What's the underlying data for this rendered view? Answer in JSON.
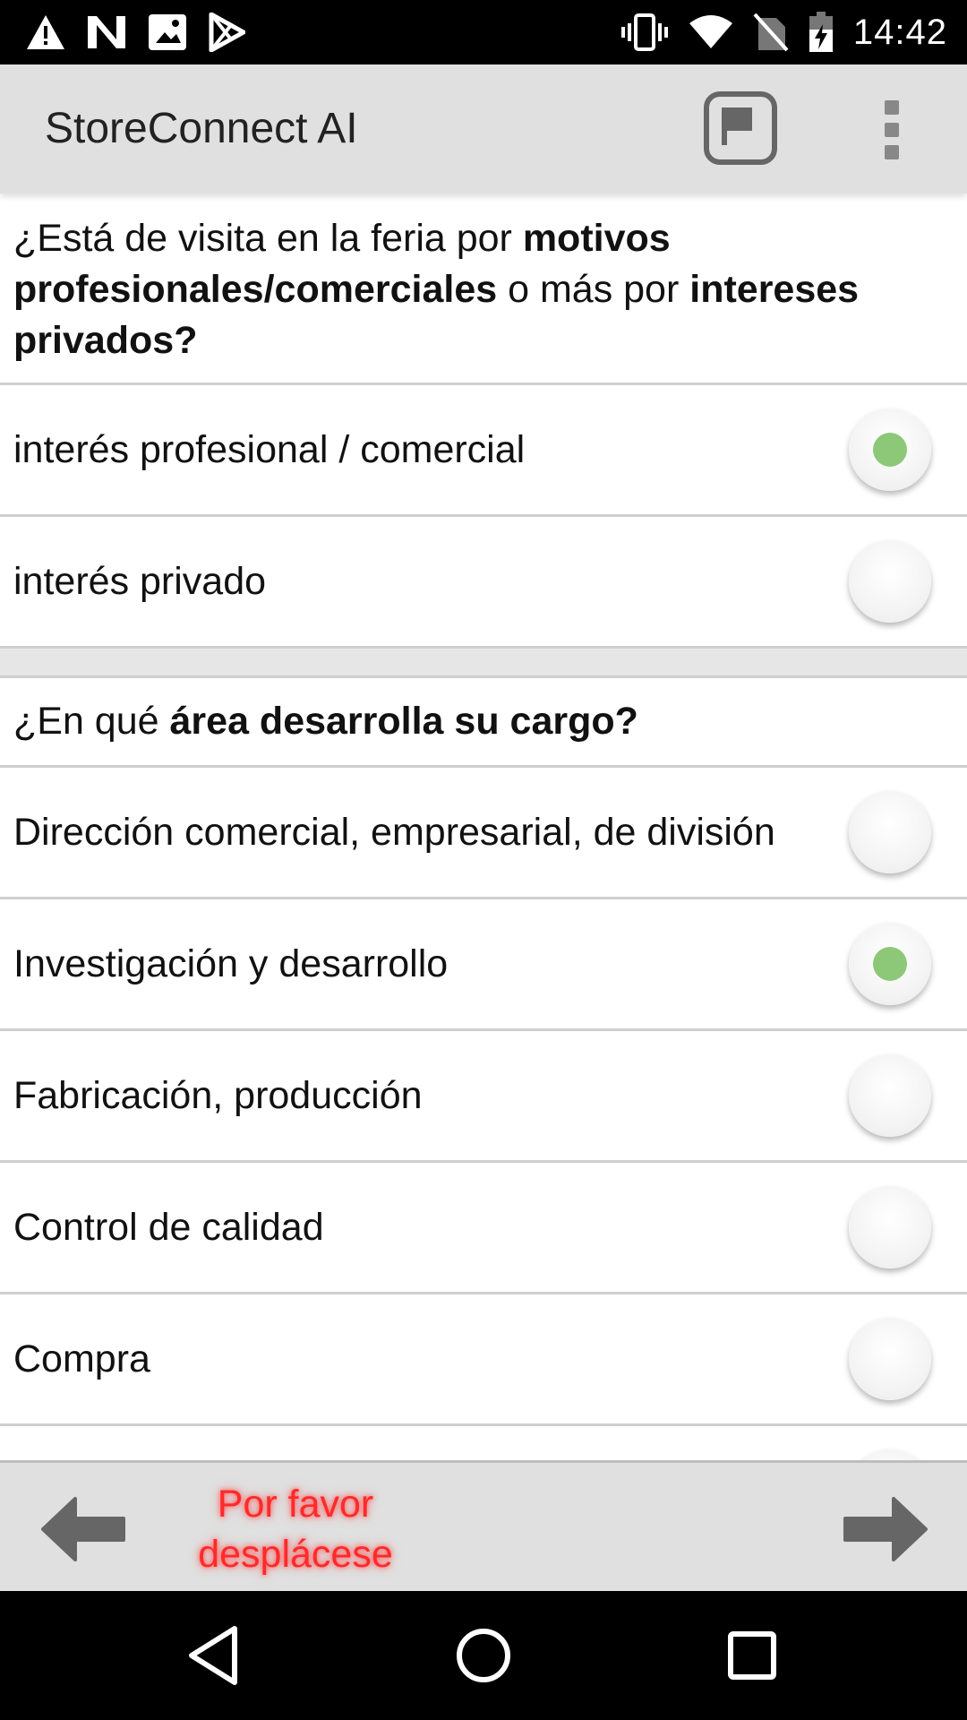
{
  "status_bar": {
    "time": "14:42",
    "left_icons": [
      "warning-icon",
      "n-icon",
      "gallery-icon",
      "play-store-icon"
    ],
    "right_icons": [
      "vibrate-icon",
      "wifi-icon",
      "no-sim-icon",
      "battery-charging-icon"
    ]
  },
  "app_bar": {
    "title": "StoreConnect AI",
    "actions": [
      "flag-icon",
      "more-vert-icon"
    ]
  },
  "questions": [
    {
      "parts": [
        {
          "text": "¿Está de visita en la feria por ",
          "bold": false
        },
        {
          "text": "motivos profesionales/comerciales",
          "bold": true
        },
        {
          "text": " o más por ",
          "bold": false
        },
        {
          "text": "intereses privados?",
          "bold": true
        }
      ],
      "options": [
        {
          "label": "interés profesional / comercial",
          "selected": true
        },
        {
          "label": "interés privado",
          "selected": false
        }
      ]
    },
    {
      "parts": [
        {
          "text": "¿En qué ",
          "bold": false
        },
        {
          "text": "área desarrolla su cargo?",
          "bold": true
        }
      ],
      "options": [
        {
          "label": "Dirección comercial, empresarial, de división",
          "selected": false
        },
        {
          "label": "Investigación y desarrollo",
          "selected": true
        },
        {
          "label": "Fabricación, producción",
          "selected": false
        },
        {
          "label": "Control de calidad",
          "selected": false
        },
        {
          "label": "Compra",
          "selected": false
        }
      ]
    }
  ],
  "bottom_nav": {
    "scroll_hint": "Por favor desplácese",
    "back_icon": "arrow-left-icon",
    "forward_icon": "arrow-right-icon"
  },
  "colors": {
    "selected_radio": "#8dc878",
    "hint_text": "#ff2a2a",
    "app_bar_bg": "#e0e0e0"
  }
}
